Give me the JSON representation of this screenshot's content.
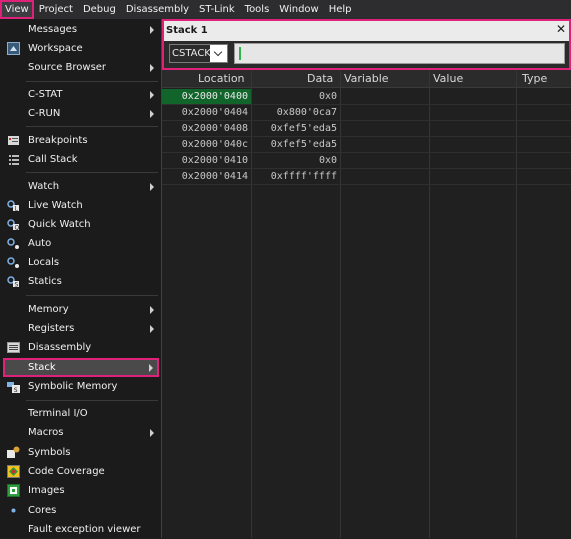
{
  "menubar": {
    "items": [
      {
        "label": "View"
      },
      {
        "label": "Project"
      },
      {
        "label": "Debug"
      },
      {
        "label": "Disassembly"
      },
      {
        "label": "ST-Link"
      },
      {
        "label": "Tools"
      },
      {
        "label": "Window"
      },
      {
        "label": "Help"
      }
    ]
  },
  "view_menu": {
    "items": [
      {
        "label": "Messages",
        "icon": "",
        "submenu": true
      },
      {
        "label": "Workspace",
        "icon": "workspace-icon",
        "submenu": false
      },
      {
        "label": "Source Browser",
        "icon": "",
        "submenu": true
      },
      {
        "label": "C-STAT",
        "icon": "",
        "submenu": true
      },
      {
        "label": "C-RUN",
        "icon": "",
        "submenu": true
      },
      {
        "label": "Breakpoints",
        "icon": "breakpoints-icon",
        "submenu": false
      },
      {
        "label": "Call Stack",
        "icon": "call-stack-icon",
        "submenu": false
      },
      {
        "label": "Watch",
        "icon": "",
        "submenu": true
      },
      {
        "label": "Live Watch",
        "icon": "live-watch-icon",
        "submenu": false
      },
      {
        "label": "Quick Watch",
        "icon": "quick-watch-icon",
        "submenu": false
      },
      {
        "label": "Auto",
        "icon": "auto-icon",
        "submenu": false
      },
      {
        "label": "Locals",
        "icon": "locals-icon",
        "submenu": false
      },
      {
        "label": "Statics",
        "icon": "statics-icon",
        "submenu": false
      },
      {
        "label": "Memory",
        "icon": "",
        "submenu": true
      },
      {
        "label": "Registers",
        "icon": "",
        "submenu": true
      },
      {
        "label": "Disassembly",
        "icon": "disassembly-icon",
        "submenu": false
      },
      {
        "label": "Stack",
        "icon": "",
        "submenu": true,
        "selected": true
      },
      {
        "label": "Symbolic Memory",
        "icon": "symbolic-memory-icon",
        "submenu": false
      },
      {
        "label": "Terminal I/O",
        "icon": "",
        "submenu": false
      },
      {
        "label": "Macros",
        "icon": "",
        "submenu": true
      },
      {
        "label": "Symbols",
        "icon": "symbols-icon",
        "submenu": false
      },
      {
        "label": "Code Coverage",
        "icon": "code-coverage-icon",
        "submenu": false
      },
      {
        "label": "Images",
        "icon": "images-icon",
        "submenu": false
      },
      {
        "label": "Cores",
        "icon": "cores-icon",
        "submenu": false
      },
      {
        "label": "Fault exception viewer",
        "icon": "",
        "submenu": false
      }
    ]
  },
  "stack_window": {
    "title": "Stack 1",
    "close": "✕",
    "stack_select": "CSTACK",
    "columns": [
      "Location",
      "Data",
      "Variable",
      "Value",
      "Type"
    ],
    "rows": [
      {
        "location": "0x2000'0400",
        "data": "0x0"
      },
      {
        "location": "0x2000'0404",
        "data": "0x800'0ca7"
      },
      {
        "location": "0x2000'0408",
        "data": "0xfef5'eda5"
      },
      {
        "location": "0x2000'040c",
        "data": "0xfef5'eda5"
      },
      {
        "location": "0x2000'0410",
        "data": "0x0"
      },
      {
        "location": "0x2000'0414",
        "data": "0xffff'ffff"
      }
    ]
  },
  "colors": {
    "highlight": "#e0217a",
    "current_row": "#11652b",
    "gauge_mark": "#2fb34a"
  }
}
